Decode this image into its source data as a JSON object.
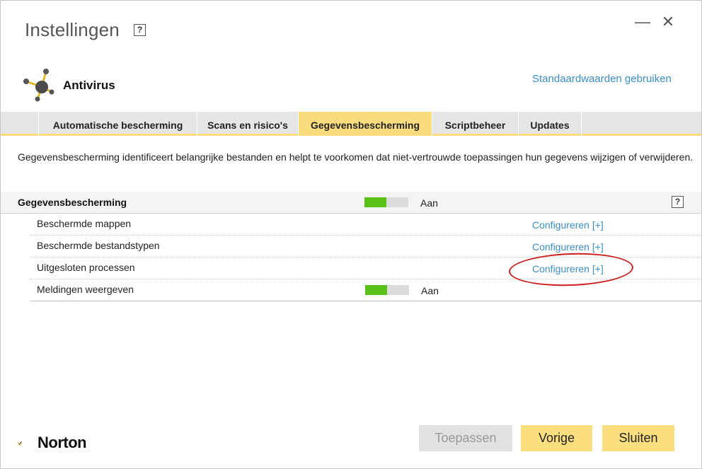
{
  "window": {
    "title": "Instellingen",
    "help_glyph": "?",
    "minimize_glyph": "—",
    "close_glyph": "✕"
  },
  "header": {
    "section_title": "Antivirus",
    "defaults_link": "Standaardwaarden gebruiken",
    "icon": "antivirus-molecule-icon"
  },
  "tabs": [
    {
      "label": "Automatische bescherming",
      "active": false
    },
    {
      "label": "Scans en risico's",
      "active": false
    },
    {
      "label": "Gegevensbescherming",
      "active": true
    },
    {
      "label": "Scriptbeheer",
      "active": false
    },
    {
      "label": "Updates",
      "active": false
    }
  ],
  "description": "Gegevensbescherming identificeert belangrijke bestanden en helpt te voorkomen dat niet-vertrouwde toepassingen hun gegevens wijzigen of verwijderen.",
  "settings": {
    "group": {
      "label": "Gegevensbescherming",
      "state": "Aan",
      "on_fraction": 0.5,
      "help_glyph": "?"
    },
    "rows": [
      {
        "label": "Beschermde mappen",
        "action": "Configureren [+]"
      },
      {
        "label": "Beschermde bestandstypen",
        "action": "Configureren [+]"
      },
      {
        "label": "Uitgesloten processen",
        "action": "Configureren [+]",
        "highlighted": true
      },
      {
        "label": "Meldingen weergeven",
        "state": "Aan",
        "on_fraction": 0.5
      }
    ]
  },
  "footer": {
    "brand": "Norton",
    "buttons": {
      "apply": "Toepassen",
      "back": "Vorige",
      "close": "Sluiten"
    }
  },
  "colors": {
    "accent": "#f8dc7d",
    "link": "#3a8fc7",
    "toggle_on": "#5ac119",
    "annotation": "#cc1f1f"
  }
}
